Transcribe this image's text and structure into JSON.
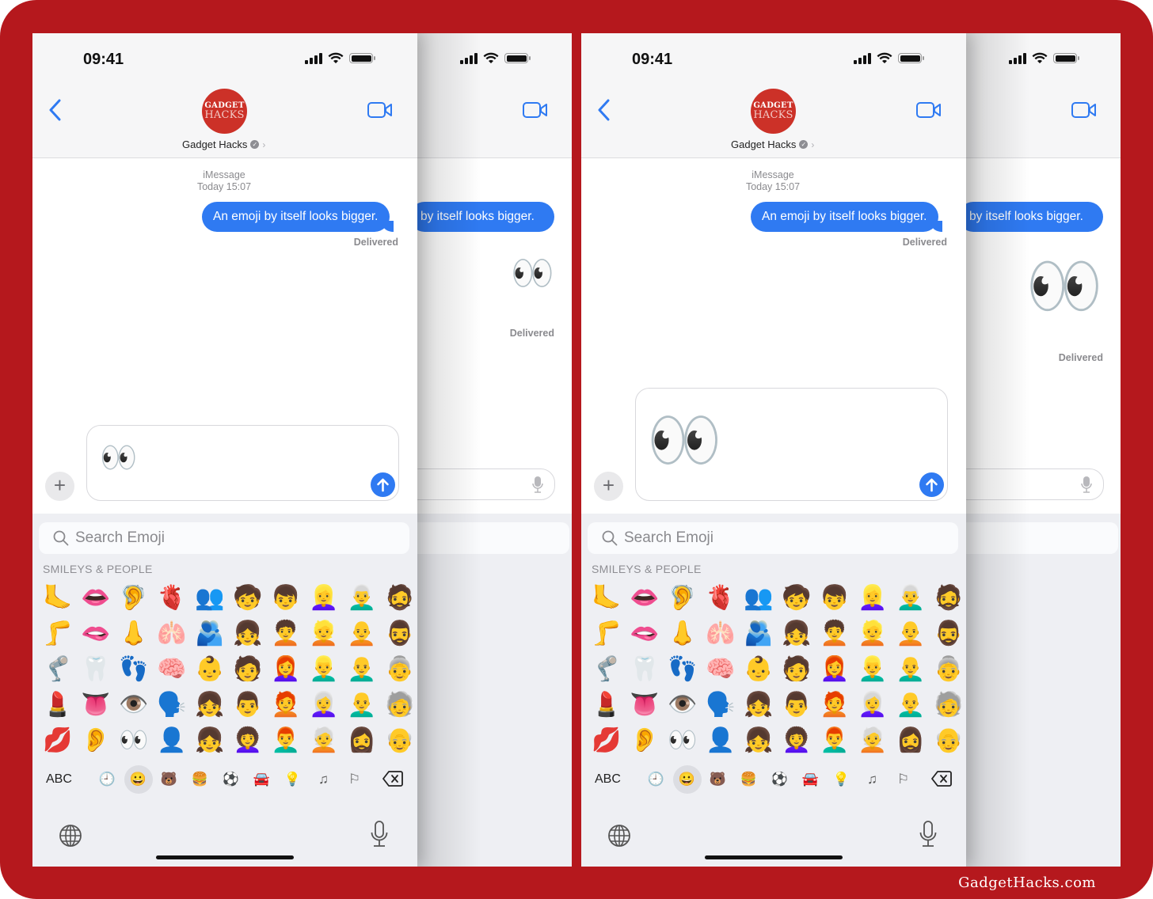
{
  "watermark": "GadgetHacks.com",
  "colors": {
    "frame": "#b5181d",
    "accent": "#2f7af2",
    "avatar": "#cc3128"
  },
  "status_bar": {
    "time": "09:41"
  },
  "header": {
    "back_icon": "chevron-left-icon",
    "contact_name": "Gadget Hacks",
    "avatar_line1": "GADGET",
    "avatar_line2": "HACKS",
    "verified_icon": "✓",
    "chevron": "›",
    "video_icon": "video-camera-icon"
  },
  "conversation": {
    "service": "iMessage",
    "timestamp": "Today 15:07",
    "message": "An emoji by itself looks bigger.",
    "message_partial": "by itself looks bigger.",
    "delivered": "Delivered",
    "sent_emoji": "👀"
  },
  "compose": {
    "plus": "+",
    "input_value": "👀",
    "send_icon": "↑"
  },
  "keyboard": {
    "search_placeholder": "Search Emoji",
    "section_title": "SMILEYS & PEOPLE",
    "emoji_rows": [
      [
        "🦶",
        "👄",
        "🦻",
        "🫀",
        "👥",
        "🧒",
        "👦",
        "👱‍♀️",
        "👨‍🦳",
        "🧔"
      ],
      [
        "🦵",
        "🫦",
        "👃",
        "🫁",
        "🫂",
        "👧",
        "🧑‍🦱",
        "👱",
        "🧑‍🦲",
        "🧔‍♂️"
      ],
      [
        "🦿",
        "🦷",
        "👣",
        "🧠",
        "👶",
        "🧑",
        "👩‍🦰",
        "👱‍♂️",
        "👨‍🦲",
        "👵"
      ],
      [
        "💄",
        "👅",
        "👁️",
        "🗣️",
        "👧",
        "👨",
        "🧑‍🦰",
        "👩‍🦳",
        "👨‍🦲",
        "🧓"
      ],
      [
        "💋",
        "👂",
        "👀",
        "👤",
        "👧",
        "👩‍🦱",
        "👨‍🦰",
        "🧑‍🦳",
        "🧔‍♀️",
        "👴"
      ]
    ],
    "abc_label": "ABC",
    "categories": [
      "🕘",
      "😀",
      "🐻",
      "🍔",
      "⚽",
      "🚘",
      "💡",
      "♫",
      "⚐"
    ],
    "delete_icon": "⌫"
  }
}
